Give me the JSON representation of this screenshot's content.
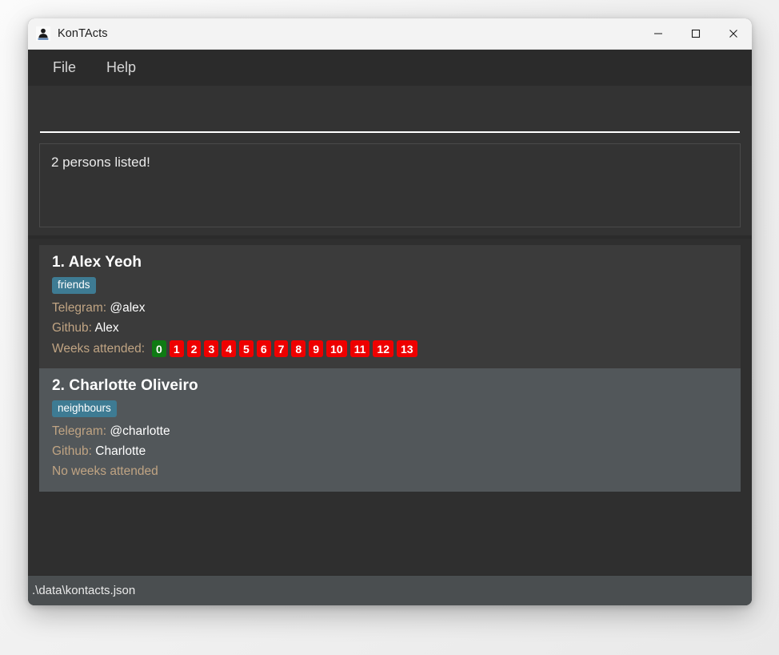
{
  "window": {
    "title": "KonTActs",
    "icon": "contact-person-icon",
    "controls": {
      "minimize": "minimize-icon",
      "maximize": "maximize-icon",
      "close": "close-icon"
    }
  },
  "menubar": {
    "items": [
      {
        "label": "File"
      },
      {
        "label": "Help"
      }
    ]
  },
  "command": {
    "value": "",
    "placeholder": ""
  },
  "result": {
    "message": "2 persons listed!"
  },
  "persons": [
    {
      "index": "1.",
      "name": "Alex Yeoh",
      "display_name": "1. Alex Yeoh",
      "tags": [
        "friends"
      ],
      "telegram_label": "Telegram:",
      "telegram_value": "@alex",
      "github_label": "Github:",
      "github_value": "Alex",
      "weeks_label": "Weeks attended:",
      "weeks": [
        {
          "num": "0",
          "attended": true
        },
        {
          "num": "1",
          "attended": false
        },
        {
          "num": "2",
          "attended": false
        },
        {
          "num": "3",
          "attended": false
        },
        {
          "num": "4",
          "attended": false
        },
        {
          "num": "5",
          "attended": false
        },
        {
          "num": "6",
          "attended": false
        },
        {
          "num": "7",
          "attended": false
        },
        {
          "num": "8",
          "attended": false
        },
        {
          "num": "9",
          "attended": false
        },
        {
          "num": "10",
          "attended": false
        },
        {
          "num": "11",
          "attended": false
        },
        {
          "num": "12",
          "attended": false
        },
        {
          "num": "13",
          "attended": false
        }
      ],
      "no_weeks_text": null,
      "selected": false
    },
    {
      "index": "2.",
      "name": "Charlotte Oliveiro",
      "display_name": "2. Charlotte Oliveiro",
      "tags": [
        "neighbours"
      ],
      "telegram_label": "Telegram:",
      "telegram_value": "@charlotte",
      "github_label": "Github:",
      "github_value": "Charlotte",
      "weeks_label": null,
      "weeks": [],
      "no_weeks_text": "No weeks attended",
      "selected": true
    }
  ],
  "statusbar": {
    "path": ".\\data\\kontacts.json"
  },
  "colors": {
    "window_bg": "#333333",
    "menubar_bg": "#2b2b2b",
    "card_bg": "#3b3b3b",
    "card_selected_bg": "#52575a",
    "tag_bg": "#3e7b93",
    "week_attended": "#0f7a14",
    "week_missed": "#ee0000",
    "field_label": "#c0a483",
    "statusbar_bg": "#4a4e50"
  }
}
